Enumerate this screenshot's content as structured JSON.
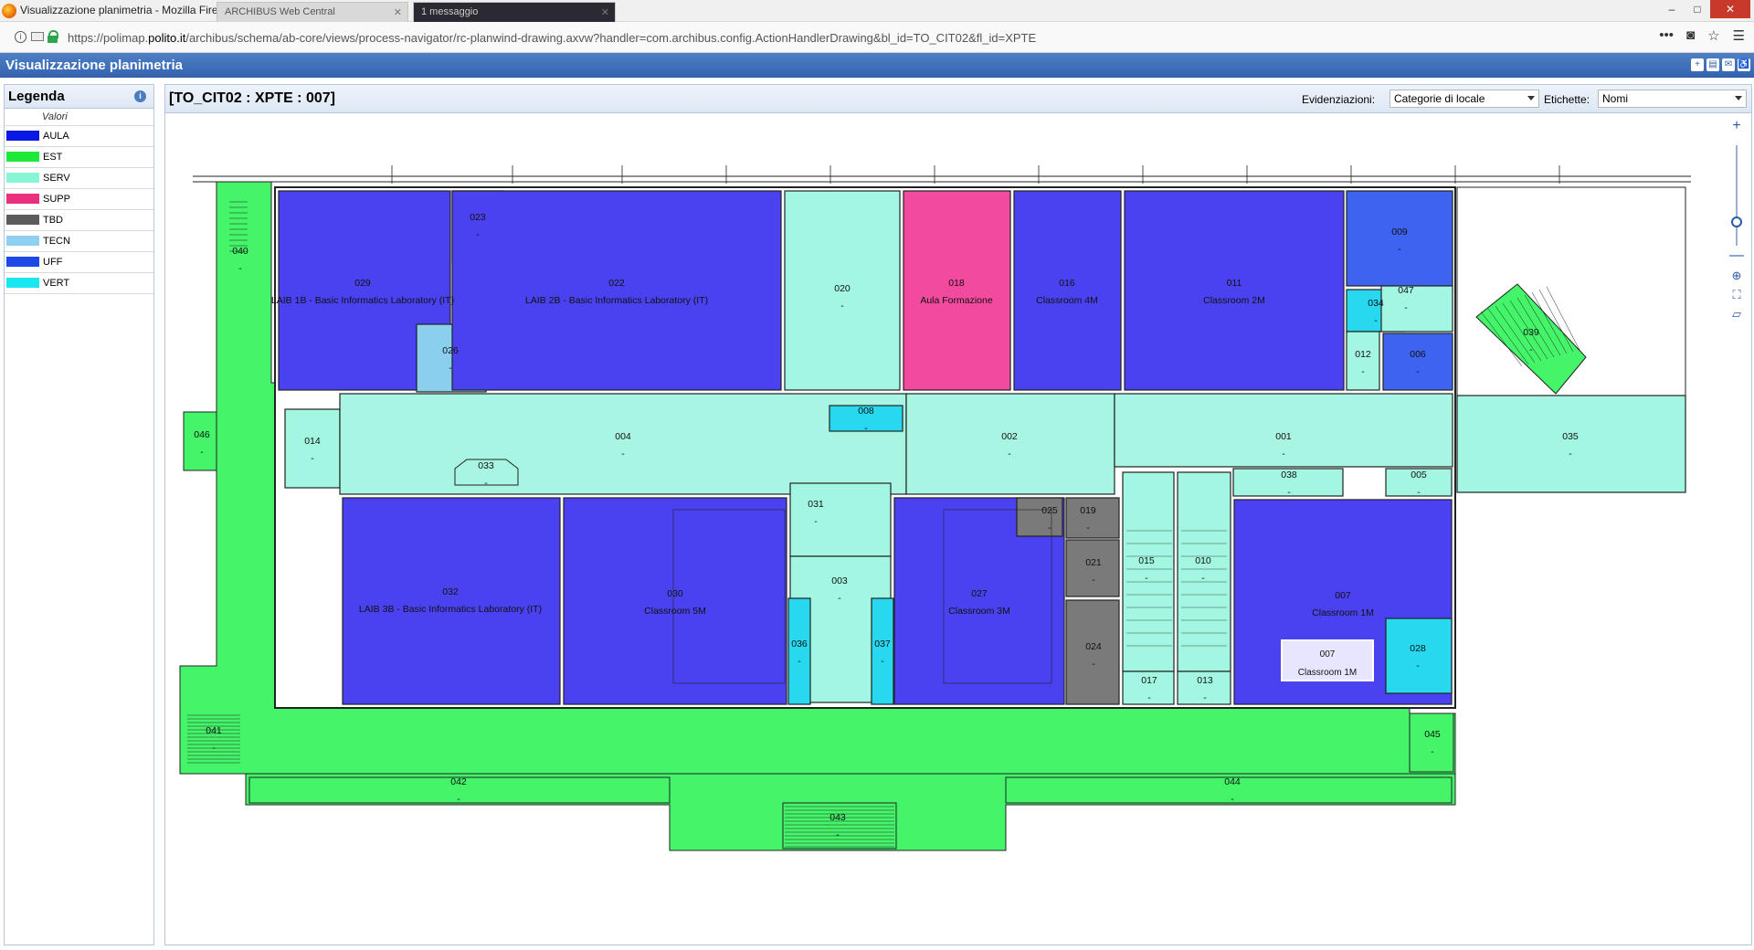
{
  "window": {
    "title": "Visualizzazione planimetria - Mozilla Firefox",
    "tabs": [
      {
        "label": "ARCHIBUS Web Central"
      },
      {
        "label": "1 messaggio"
      }
    ],
    "controls": {
      "minimize": "–",
      "maximize": "□",
      "close": "✕"
    }
  },
  "addressbar": {
    "url_prefix": "https://polimap.",
    "url_host": "polito.it",
    "url_rest": "/archibus/schema/ab-core/views/process-navigator/rc-planwind-drawing.axvw?handler=com.archibus.config.ActionHandlerDrawing&bl_id=TO_CIT02&fl_id=XPTE",
    "icons": [
      "info-icon",
      "page-icon",
      "lock-icon",
      "more-icon",
      "pocket-icon",
      "star-icon",
      "menu-icon"
    ]
  },
  "app": {
    "title": "Visualizzazione planimetria",
    "header_icons": [
      "expand-icon",
      "print-icon",
      "email-icon",
      "accessibility-icon"
    ]
  },
  "legend": {
    "title": "Legenda",
    "column_header": "Valori",
    "items": [
      {
        "label": "AULA",
        "color": "#0a18e6"
      },
      {
        "label": "EST",
        "color": "#1ee83a"
      },
      {
        "label": "SERV",
        "color": "#8af5d6"
      },
      {
        "label": "SUPP",
        "color": "#ea2f7e"
      },
      {
        "label": "TBD",
        "color": "#5c5c5c"
      },
      {
        "label": "TECN",
        "color": "#8fd0f0"
      },
      {
        "label": "UFF",
        "color": "#1f48e8"
      },
      {
        "label": "VERT",
        "color": "#1ae8f0"
      }
    ]
  },
  "drawing": {
    "title": "[TO_CIT02 : XPTE : 007]",
    "highlight_label": "Evidenziazioni:",
    "highlight_value": "Categorie di locale",
    "labels_label": "Etichette:",
    "labels_value": "Nomi",
    "zoom_tools": [
      "zoom-in-icon",
      "zoom-out-icon",
      "center-icon",
      "fit-icon",
      "select-icon"
    ],
    "rooms": [
      {
        "id": "040",
        "name": "-"
      },
      {
        "id": "029",
        "name": "LAIB 1B - Basic Informatics Laboratory (IT)"
      },
      {
        "id": "023",
        "name": "-"
      },
      {
        "id": "022",
        "name": "LAIB 2B - Basic Informatics Laboratory (IT)"
      },
      {
        "id": "026",
        "name": "-"
      },
      {
        "id": "020",
        "name": "-"
      },
      {
        "id": "018",
        "name": "Aula Formazione"
      },
      {
        "id": "016",
        "name": "Classroom 4M"
      },
      {
        "id": "011",
        "name": "Classroom 2M"
      },
      {
        "id": "009",
        "name": "-"
      },
      {
        "id": "034",
        "name": "-"
      },
      {
        "id": "047",
        "name": "-"
      },
      {
        "id": "012",
        "name": "-"
      },
      {
        "id": "006",
        "name": "-"
      },
      {
        "id": "039",
        "name": "-"
      },
      {
        "id": "035",
        "name": "-"
      },
      {
        "id": "046",
        "name": "-"
      },
      {
        "id": "014",
        "name": "-"
      },
      {
        "id": "004",
        "name": "-"
      },
      {
        "id": "008",
        "name": "-"
      },
      {
        "id": "002",
        "name": "-"
      },
      {
        "id": "001",
        "name": "-"
      },
      {
        "id": "033",
        "name": "-"
      },
      {
        "id": "038",
        "name": "-"
      },
      {
        "id": "005",
        "name": "-"
      },
      {
        "id": "031",
        "name": "-"
      },
      {
        "id": "025",
        "name": "-"
      },
      {
        "id": "019",
        "name": "-"
      },
      {
        "id": "021",
        "name": "-"
      },
      {
        "id": "024",
        "name": "-"
      },
      {
        "id": "015",
        "name": "-"
      },
      {
        "id": "010",
        "name": "-"
      },
      {
        "id": "017",
        "name": "-"
      },
      {
        "id": "013",
        "name": "-"
      },
      {
        "id": "032",
        "name": "LAIB 3B - Basic Informatics Laboratory (IT)"
      },
      {
        "id": "030",
        "name": "Classroom 5M"
      },
      {
        "id": "003",
        "name": "-"
      },
      {
        "id": "036",
        "name": "-"
      },
      {
        "id": "037",
        "name": "-"
      },
      {
        "id": "027",
        "name": "Classroom 3M"
      },
      {
        "id": "007",
        "name": "Classroom 1M"
      },
      {
        "id": "028",
        "name": "-"
      },
      {
        "id": "041",
        "name": "-"
      },
      {
        "id": "045",
        "name": "-"
      },
      {
        "id": "042",
        "name": "-"
      },
      {
        "id": "044",
        "name": "-"
      },
      {
        "id": "043",
        "name": "-"
      }
    ],
    "tooltip": {
      "id": "007",
      "name": "Classroom 1M"
    }
  }
}
